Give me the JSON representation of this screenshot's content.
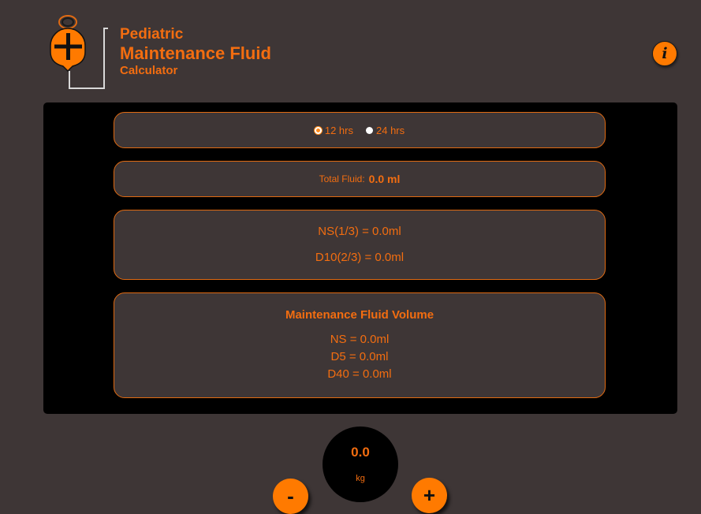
{
  "header": {
    "title_line1": "Pediatric",
    "title_line2": "Maintenance Fluid",
    "title_line3": "Calculator",
    "info_label": "i"
  },
  "period": {
    "options": [
      {
        "label": "12 hrs",
        "checked": true
      },
      {
        "label": "24 hrs",
        "checked": false
      }
    ]
  },
  "total": {
    "label": "Total Fluid:",
    "value": "0.0 ml"
  },
  "ratio": {
    "ns": "NS(1/3) = 0.0ml",
    "d10": "D10(2/3) = 0.0ml"
  },
  "maintenance": {
    "title": "Maintenance Fluid Volume",
    "ns": "NS = 0.0ml",
    "d5": "D5 = 0.0ml",
    "d40": "D40 = 0.0ml"
  },
  "weight": {
    "value": "0.0",
    "unit": "kg",
    "minus_label": "-",
    "plus_label": "+"
  },
  "colors": {
    "accent": "#f36d10",
    "background": "#3e3636",
    "panel": "#000000"
  },
  "icons": {
    "logo": "iv-bag-plus-icon",
    "info": "info-icon"
  }
}
